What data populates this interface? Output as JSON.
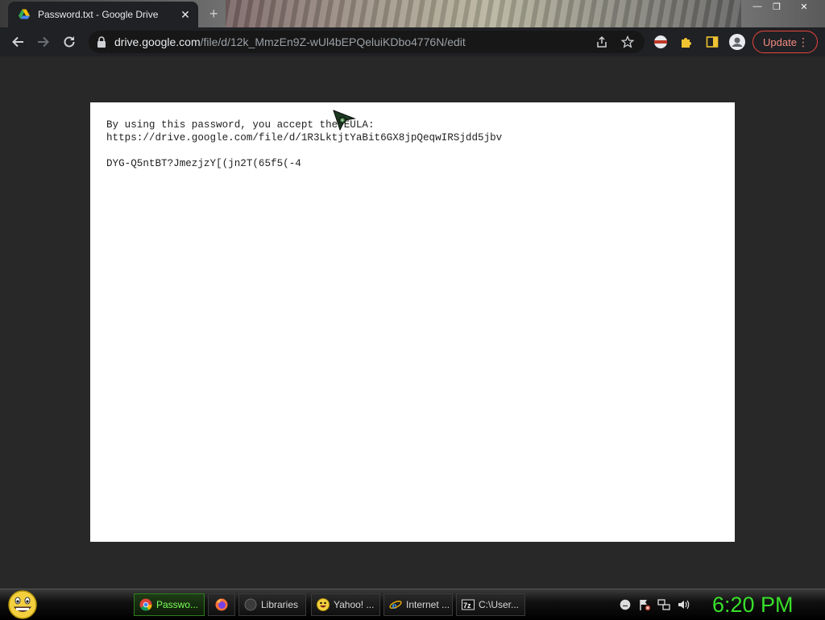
{
  "browser": {
    "tab": {
      "title": "Password.txt - Google Drive",
      "close": "✕"
    },
    "new_tab": "+",
    "window_controls": {
      "minimize": "—",
      "maximize": "❐",
      "close": "✕"
    },
    "address": {
      "domain": "drive.google.com",
      "path": "/file/d/12k_MmzEn9Z-wUl4bEPQeluiKDbo4776N/edit"
    },
    "update_button": {
      "label": "Update",
      "menu": "⋮"
    }
  },
  "document": {
    "lines": [
      "By using this password, you accept the EULA:",
      "https://drive.google.com/file/d/1R3LktjtYaBit6GX8jpQeqwIRSjdd5jbv",
      "",
      "DYG-Q5ntBT?JmezjzY[(jn2T(65f5(-4"
    ]
  },
  "taskbar": {
    "tasks": [
      {
        "label": "Passwo...",
        "icon": "chrome-icon",
        "active": true
      },
      {
        "label": "",
        "icon": "firefox-icon",
        "active": false
      },
      {
        "label": "Libraries",
        "icon": "libraries-icon",
        "active": false
      },
      {
        "label": "Yahoo! ...",
        "icon": "yahoo-messenger-icon",
        "active": false
      },
      {
        "label": "Internet ...",
        "icon": "internet-explorer-icon",
        "active": false
      },
      {
        "label": "C:\\User...",
        "icon": "7zip-icon",
        "active": false
      }
    ],
    "clock": "6:20 PM"
  },
  "colors": {
    "page_bg": "#282828",
    "doc_bg": "#ffffff",
    "clock": "#38e02a",
    "update_accent": "#e8453c"
  }
}
